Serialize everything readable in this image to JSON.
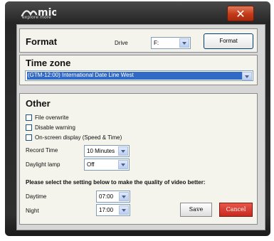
{
  "window": {
    "close_label": "✕",
    "logo_text": "mio",
    "logo_tagline": "explore more"
  },
  "format": {
    "title": "Format",
    "drive_label": "Drive",
    "drive_value": "F:",
    "button_label": "Format"
  },
  "timezone": {
    "title": "Time zone",
    "selected": "(GTM-12:00) International Date Line West"
  },
  "other": {
    "title": "Other",
    "checkboxes": [
      {
        "label": "File overwrite",
        "checked": false
      },
      {
        "label": "Disable warning",
        "checked": false
      },
      {
        "label": "On-screen display (Speed & Time)",
        "checked": false
      }
    ],
    "record_time_label": "Record Time",
    "record_time_value": "10 Minutes",
    "daylight_lamp_label": "Daylight lamp",
    "daylight_lamp_value": "Off",
    "quality_note": "Please select the setting below to make the quality of video better:",
    "daytime_label": "Daytime",
    "daytime_value": "07:00",
    "night_label": "Night",
    "night_value": "17:00"
  },
  "actions": {
    "save_label": "Save",
    "cancel_label": "Cancel"
  },
  "colors": {
    "accent_blue": "#316ac5",
    "cancel_red": "#c8281e",
    "close_red": "#c23a18"
  }
}
